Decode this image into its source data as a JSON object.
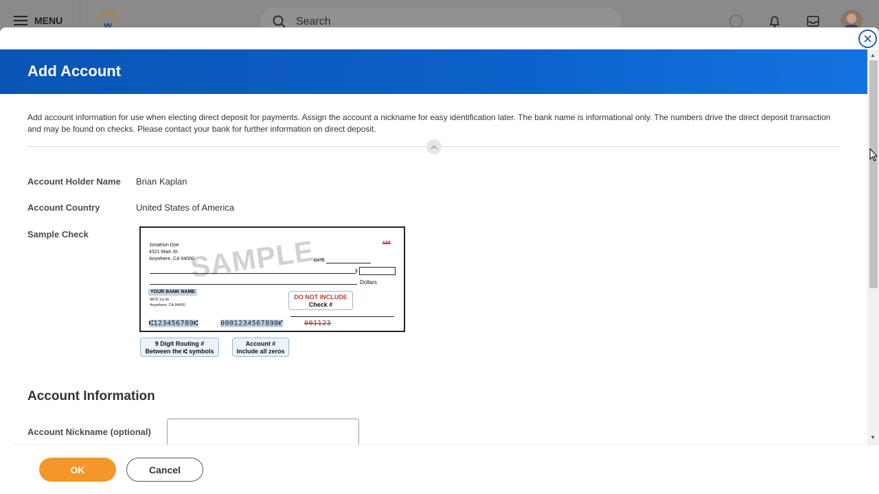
{
  "app_header": {
    "menu_label": "MENU",
    "search_placeholder": "Search"
  },
  "modal": {
    "title": "Add Account",
    "intro": "Add account information for use when electing direct deposit for payments. Assign the account a nickname for easy identification later. The bank name is informational only. The numbers drive the direct deposit transaction and may be found on checks.  Please contact your bank for further information on direct deposit.",
    "fields": {
      "holder_label": "Account Holder Name",
      "holder_value": "Brian Kaplan",
      "country_label": "Account Country",
      "country_value": "United States of America",
      "sample_check_label": "Sample Check"
    },
    "check": {
      "name": "Jonathon Doe",
      "street": "4321 Main St.",
      "city": "Anywhere, CA 94000",
      "number": "123",
      "date_label": "DATE",
      "dollar_sign": "$",
      "dollars_label": "Dollars",
      "watermark": "SAMPLE",
      "bank_name": "YOUR BANK NAME",
      "bank_street": "9876 1st St.",
      "bank_city": "Anywhere, CA 94000",
      "do_not_include": "DO NOT INCLUDE",
      "check_num_label": "Check #",
      "routing_micr": "⑆123456789⑆",
      "account_micr": "0001234567890⑈",
      "check_micr": "001123",
      "routing_callout_1": "9 Digit  Routing #",
      "routing_callout_2": "Between the ⑆ symbols",
      "account_callout_1": "Account #",
      "account_callout_2": "Include all zeros"
    },
    "section_title": "Account Information",
    "nickname_label": "Account Nickname (optional)",
    "nickname_value": "",
    "ok_label": "OK",
    "cancel_label": "Cancel"
  },
  "colors": {
    "header_blue": "#0c62cb",
    "ok_orange": "#f4962a",
    "close_blue": "#1c5db8"
  }
}
